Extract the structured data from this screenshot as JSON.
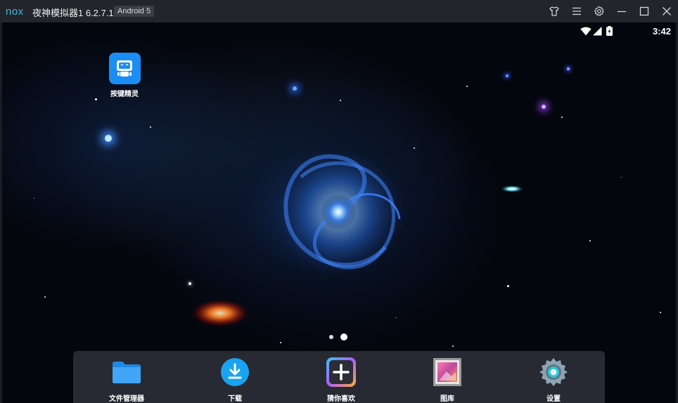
{
  "window": {
    "title": "夜神模拟器1 6.2.7.1",
    "android_badge": "Android 5",
    "buttons": [
      "shirt-icon",
      "menu-icon",
      "gear-icon",
      "minimize-icon",
      "maximize-icon",
      "close-icon"
    ]
  },
  "status_bar": {
    "time": "3:42",
    "icons": [
      "wifi-icon",
      "signal-icon",
      "battery-icon"
    ]
  },
  "desktop": {
    "icons": [
      {
        "label": "按键精灵",
        "icon": "robot-icon",
        "color": "#1a8ef3"
      }
    ],
    "pager": {
      "pages": 2,
      "current": 2
    }
  },
  "dock": {
    "items": [
      {
        "label": "文件管理器",
        "icon": "folder-icon"
      },
      {
        "label": "下载",
        "icon": "download-icon"
      },
      {
        "label": "猜你喜欢",
        "icon": "plus-icon"
      },
      {
        "label": "图库",
        "icon": "gallery-icon"
      },
      {
        "label": "设置",
        "icon": "settings-icon"
      }
    ]
  },
  "colors": {
    "titlebar": "#23252d",
    "accent": "#1a8ef3",
    "logo": "#3fb8d6"
  }
}
